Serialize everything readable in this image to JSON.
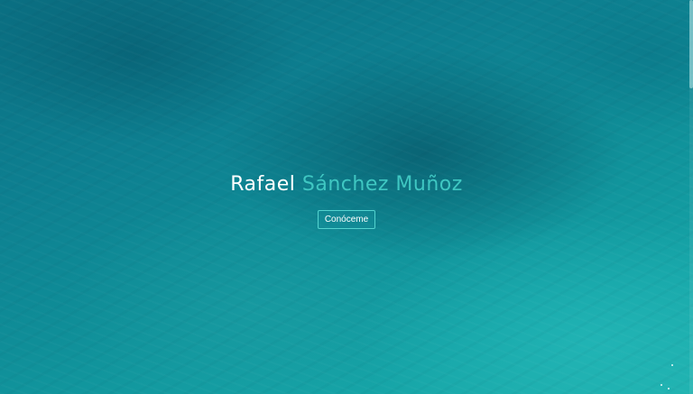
{
  "hero": {
    "first_name": "Rafael",
    "last_name": "Sánchez Muñoz",
    "cta_label": "Conóceme"
  },
  "colors": {
    "background_top": "#0a6f82",
    "background_bottom": "#1fb0ad",
    "name_first": "#ffffff",
    "name_accent": "#3fc7c2",
    "button_border": "#53d3cf"
  }
}
